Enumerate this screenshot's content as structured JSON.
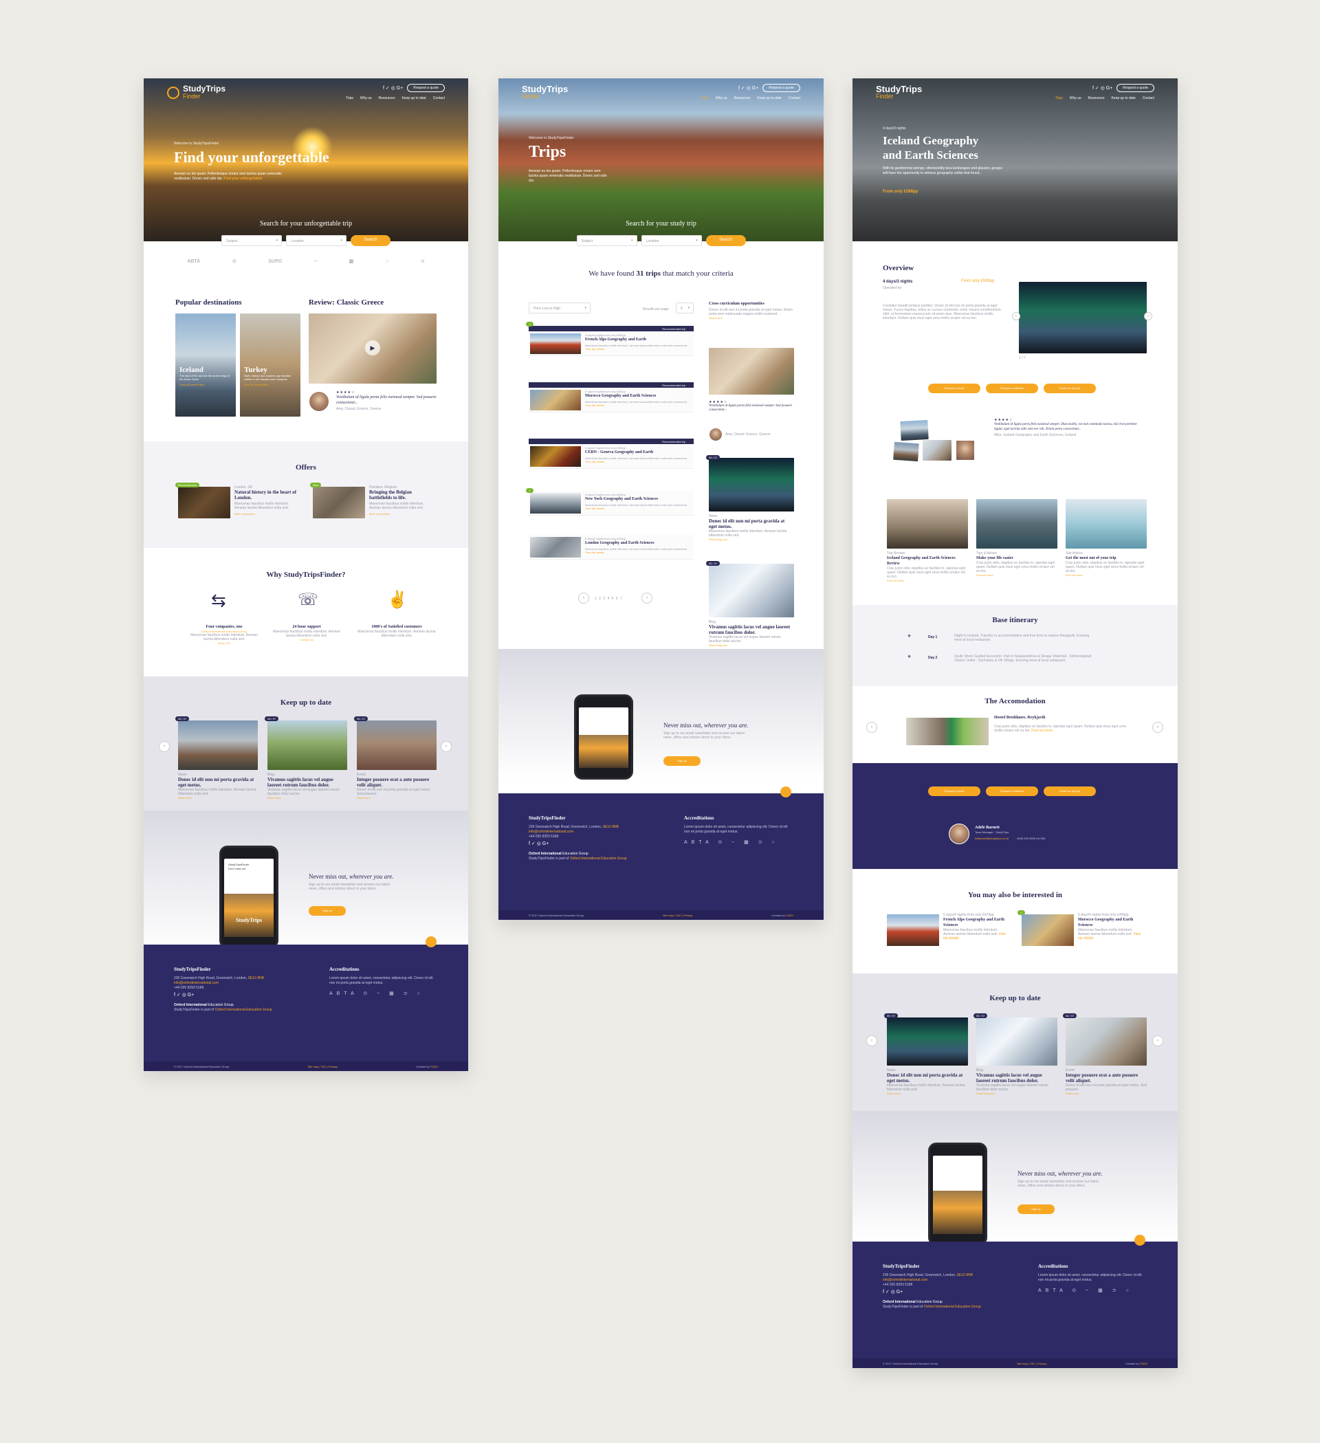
{
  "p1": {
    "logo_main": "StudyTrips",
    "logo_sub": "Finder",
    "social": "f  ✓  ◎  G+",
    "quote_btn": "Request a quote",
    "nav": [
      "Trips",
      "Why us",
      "Resources",
      "Keep up to date",
      "Contact"
    ],
    "welcome": "Welcome to StudyTripsFinder",
    "hero_title": "Find your unforgettable",
    "hero_text": "Aenean eu leo quam. Pellentesque ornare sem lacinia quam venenatis vestibulum. Donec sed odio dui.",
    "hero_link": "Find your unforgettable",
    "search_label": "Search for your unforgettable trip",
    "sel_subject": "Subject",
    "sel_location": "Location",
    "search_btn": "Search",
    "logos": [
      "ABTA",
      "⊙",
      "SUPO",
      "~",
      "▦",
      "○",
      "⊃"
    ],
    "popular_title": "Popular destinations",
    "review_title": "Review: Classic Greece",
    "dest1": {
      "name": "Iceland",
      "text": "The land of fire and ice lies at the edge of the Arctic Circle",
      "link": "View all Iceland trips"
    },
    "dest2": {
      "name": "Turkey",
      "text": "Myth, history and modern-day Istanbul collide in the bazaars and mosques",
      "link": "View all Turkey trips"
    },
    "review_stars": "★★★★☆",
    "review_quote": "Vestibulum id ligula porta felis euismod semper. Sed posuere consectetur...",
    "review_author": "Amy, Classic Greece, Greece",
    "offers_title": "Offers",
    "offer1": {
      "badge": "Recommended",
      "loc": "London, UK",
      "title": "Natural history in the heart of London.",
      "text": "Maecenas faucibus mollis interdum. Aenean lacinia bibendum nulla sed.",
      "link": "More information"
    },
    "offer2": {
      "badge": "New",
      "loc": "Flanders, Belgium",
      "title": "Bringing the Belgian battlefields to life.",
      "text": "Maecenas faucibus mollis interdum. Aenean lacinia bibendum nulla sed.",
      "link": "More information"
    },
    "why_title": "Why StudyTripsFinder?",
    "why1": {
      "title": "Four companies, one",
      "sub": "Oxford International Education Group",
      "text": "Maecenas faucibus mollis interdum. Aenean lacinia bibendum nulla sed.",
      "link": "About OTI"
    },
    "why2": {
      "title": "24 hour support",
      "text": "Maecenas faucibus mollis interdum. Aenean lacinia bibendum nulla sed.",
      "link": "Contact us"
    },
    "why3": {
      "title": "1000's of Satisfied customers",
      "text": "Maecenas faucibus mollis interdum. Aenean lacinia bibendum nulla sed."
    },
    "keep_title": "Keep up to date",
    "blog": [
      {
        "date": "06 / 07",
        "cat": "News",
        "title": "Donec id elit non mi porta gravida at eget metus.",
        "text": "Maecenas faucibus mollis interdum. Aenean lacinia bibendum nulla sed.",
        "link": "Read more"
      },
      {
        "date": "06 / 07",
        "cat": "Blog",
        "title": "Vivamus sagittis lacus vel augue laoreet rutrum faucibus dolor.",
        "text": "Vivamus sagittis lacus vel augue laoreet rutrum faucibus dolor auctor.",
        "link": "Read more"
      },
      {
        "date": "06 / 07",
        "cat": "Event",
        "title": "Integer posuere erat a ante posuere velit aliquet.",
        "text": "Donec id elit non mi porta gravida at eget metus. Sed posuere.",
        "link": "Read more"
      }
    ],
    "app_title_a": "Never miss out,",
    "app_title_b": "wherever you are.",
    "app_text": "Sign up to our email newsletter and receive our latest news, offers and articles direct to your inbox.",
    "app_btn": "Sign up",
    "phone_l1": "StudyTripsFinder",
    "phone_l2": "Don't miss out",
    "phone_l3": "StudyTrips",
    "footer": {
      "name": "StudyTripsFinder",
      "addr": "239 Greenwich High Road, Greenwich, London,",
      "postcode": "SE10 8NB",
      "email": "info@oxfordinternational.com",
      "phone": "+44 020 8293 5188",
      "social": "f  ✓  ◎  G+",
      "group": "Oxford International",
      "group_sub": "Education Group",
      "note": "StudyTripsFinder is part of",
      "note_link": "Oxford International Education Group",
      "accr_title": "Accreditations",
      "accr_text": "Lorem ipsum dolor sit amet, consectetur adipiscing elit. Donec id elit non mi porta gravida at eget metus.",
      "copy": "© 2017 Oxford International Education Group",
      "links": "Site map  |  T&C  |  Privacy",
      "credit": "Created by",
      "credit_link": "TGDH"
    }
  },
  "p2": {
    "logo_main": "StudyTrips",
    "logo_sub": "Finder",
    "social": "f  ✓  ◎  G+",
    "quote_btn": "Request a quote",
    "nav": [
      "Trips",
      "Why us",
      "Resources",
      "Keep up to date",
      "Contact"
    ],
    "welcome": "Welcome to StudyTripsFinder",
    "hero_title": "Trips",
    "hero_text": "Aenean eu leo quam. Pellentesque ornare sem lacinia quam venenatis vestibulum. Donec sed odio dui.",
    "search_label": "Search for your study trip",
    "sel_subject": "Subject",
    "sel_location": "Location",
    "search_btn": "Search",
    "found_a": "We have found",
    "found_count": "31 trips",
    "found_b": "that match your criteria",
    "sort": "Price Low to High",
    "per_page_label": "Results per page",
    "per_page": "5",
    "rec_label": "Recommended trip",
    "trips": [
      {
        "meta": "5 days/4 nights from only £549pp",
        "title": "French Alps Geography and Earth",
        "text": "Maecenas faucibus mollis interdum. Aenean lacinia bibendum nulla sed consectetur.",
        "link": "View trip details",
        "rec": true
      },
      {
        "meta": "5 days/4 nights from only £499pp",
        "title": "Morocco Geography and Earth Sciences",
        "text": "Maecenas faucibus mollis interdum. Aenean lacinia bibendum nulla sed consectetur.",
        "link": "View trip details",
        "rec": true
      },
      {
        "meta": "4 days/3 nights from only £399pp",
        "title": "CERN - Geneva Geography and Earth",
        "text": "Maecenas faucibus mollis interdum. Aenean lacinia bibendum nulla sed consectetur.",
        "link": "View trip details",
        "rec": true
      },
      {
        "meta": "5 days/4 nights from only £649pp",
        "title": "New York Geography and Earth Sciences",
        "text": "Maecenas faucibus mollis interdum. Aenean lacinia bibendum nulla sed consectetur.",
        "link": "View trip details",
        "rec": false
      },
      {
        "meta": "3 days/2 nights from only £199pp",
        "title": "London Geography and Earth Sciences",
        "text": "Maecenas faucibus mollis interdum. Aenean lacinia bibendum nulla sed consectetur.",
        "link": "View trip details",
        "rec": false
      }
    ],
    "pages": "1 2 3 4 5 6 7",
    "side_title": "Cross curriculum opportunities",
    "side_text": "Donec id elit non mi porta gravida at eget metus. Etiam porta sem malesuada magna mollis euismod.",
    "side_link": "Read more",
    "side_stars": "★★★★☆",
    "side_quote": "Vestibulum id ligula porta felis euismod semper. Sed posuere consectetur...",
    "side_author": "Amy, Classic Greece, Greece",
    "side_blog": [
      {
        "date": "06 / 07",
        "cat": "News",
        "title": "Donec id elit non mi porta gravida at eget metus.",
        "text": "Maecenas faucibus mollis interdum. Aenean lacinia bibendum nulla sed.",
        "link": "Read blog post"
      },
      {
        "date": "06 / 07",
        "cat": "Blog",
        "title": "Vivamus sagittis lacus vel augue laoreet rutrum faucibus dolor.",
        "text": "Vivamus sagittis lacus vel augue laoreet rutrum faucibus dolor auctor.",
        "link": "Read blog post"
      }
    ],
    "app_title_a": "Never miss out,",
    "app_title_b": "wherever you are.",
    "app_text": "Sign up to our email newsletter and receive our latest news, offers and articles direct to your inbox.",
    "app_btn": "Sign up",
    "footer": {
      "name": "StudyTripsFinder",
      "addr": "239 Greenwich High Road, Greenwich, London,",
      "postcode": "SE10 8NB",
      "email": "info@oxfordinternational.com",
      "phone": "+44 020 8293 5188",
      "social": "f  ✓  ◎  G+",
      "group": "Oxford International",
      "group_sub": "Education Group",
      "note": "StudyTripsFinder is part of",
      "note_link": "Oxford International Education Group",
      "accr_title": "Accreditations",
      "accr_text": "Lorem ipsum dolor sit amet, consectetur adipiscing elit. Donec id elit non mi porta gravida at eget metus.",
      "copy": "© 2017 Oxford International Education Group",
      "links": "Site map  |  T&C  |  Privacy",
      "credit": "Created by",
      "credit_link": "TGDH"
    }
  },
  "p3": {
    "logo_main": "StudyTrips",
    "logo_sub": "Finder",
    "social": "f  ✓  ◎  G+",
    "quote_btn": "Request a quote",
    "nav": [
      "Trips",
      "Why us",
      "Resources",
      "Keep up to date",
      "Contact"
    ],
    "duration": "4 days/3 nights",
    "hero_title_1": "Iceland Geography",
    "hero_title_2": "and Earth Sciences",
    "hero_text": "With its geothermal springs, otherworldly lava landscapes and glaciers, groups will have the opportunity to witness geography unlike that found...",
    "hero_price": "From only £599pp",
    "overview_title": "Overview",
    "ov_duration": "4 days/3 nights",
    "ov_price": "From only £599pp",
    "ov_provider": "Operated by",
    "ov_text": "Curabitur blandit tempus porttitor. Donec id elit non mi porta gravida at eget metus. Fusce dapibus, tellus ac cursus commodo, tortor mauris condimentum nibh, ut fermentum massa justo sit amet risus. Maecenas faucibus mollis interdum. Nullam quis risus eget urna mollis ornare vel eu leo.",
    "gallery_count": "1 / 7",
    "btn_quote": "Request a quote",
    "btn_callback": "Request a callback",
    "btn_email": "Email me my trip",
    "t_stars": "★★★★☆",
    "t_quote": "Vestibulum id ligula porta felis euismod semper. Duis mollis, est non commodo luctus, nisi erat porttitor ligula, eget lacinia odio sem nec elit. Etiam porta consectetur...",
    "t_author": "Mike, Iceland Geography and Earth Sciences, Iceland",
    "feat": [
      {
        "cat": "Trip Review",
        "title": "Iceland Geography and Earth Sciences Review",
        "text": "Cras justo odio, dapibus ac facilisis in, egestas eget quam. Nullam quis risus eget urna mollis ornare vel eu leo.",
        "link": "Find out more"
      },
      {
        "cat": "Tips & Advice",
        "title": "Make your life easier",
        "text": "Cras justo odio, dapibus ac facilisis in, egestas eget quam. Nullam quis risus eget urna mollis ornare vel eu leo.",
        "link": "Find out more"
      },
      {
        "cat": "Site Advice",
        "title": "Get the most out of your trip",
        "text": "Cras justo odio, dapibus ac facilisis in, egestas eget quam. Nullam quis risus eget urna mollis ornare vel eu leo.",
        "link": "Find out more"
      }
    ],
    "itin_title": "Base itinerary",
    "itin": [
      {
        "day": "Day 1",
        "text": "Flight to Iceland. Transfer to accommodation and free time to explore Reykjavik. Evening meal at local restaurant."
      },
      {
        "day": "Day 2",
        "text": "South Shore Guided Excursion: Visit to Seljalandsfoss & Skogar Waterfall - Solheimajokull Glacier Outlet - Dyrholaey & Vik Village. Evening meal at local restaurant."
      }
    ],
    "acc_title": "The Accomodation",
    "acc_name": "Hostel Broddanes, Reykjavik",
    "acc_text": "Cras justo odio, dapibus ac facilisis in, egestas eget quam. Nullam quis risus eget urna mollis ornare vel eu leo.",
    "acc_link": "Find out more",
    "contact_name": "Adele Barnett",
    "contact_role": "Team Manager - StudyTrips",
    "contact_email": "Adbarnett@studytrips.co.uk",
    "contact_phone": "0845 200 5555 ext 555",
    "also_title": "You may also be interested in",
    "also": [
      {
        "meta": "5 days/4 nights from only £479pp",
        "title": "French Alps Geography and Earth Sciences",
        "text": "Maecenas faucibus mollis interdum. Aenean lacinia bibendum nulla sed.",
        "link": "View trip details"
      },
      {
        "meta": "5 days/4 nights from only £499pp",
        "title": "Morocco Geography and Earth Sciences",
        "text": "Maecenas faucibus mollis interdum. Aenean lacinia bibendum nulla sed.",
        "link": "View trip details"
      }
    ],
    "keep_title": "Keep up to date",
    "blog": [
      {
        "date": "06 / 07",
        "cat": "News",
        "title": "Donec id elit non mi porta gravida at eget metus.",
        "text": "Maecenas faucibus mollis interdum. Aenean lacinia bibendum nulla sed.",
        "link": "Read more"
      },
      {
        "date": "06 / 07",
        "cat": "Blog",
        "title": "Vivamus sagittis lacus vel augue laoreet rutrum faucibus dolor.",
        "text": "Vivamus sagittis lacus vel augue laoreet rutrum faucibus dolor auctor.",
        "link": "Read blog post"
      },
      {
        "date": "06 / 07",
        "cat": "Event",
        "title": "Integer posuere erat a ante posuere velit aliquet.",
        "text": "Donec id elit non mi porta gravida at eget metus. Sed posuere.",
        "link": "Read more"
      }
    ],
    "app_title_a": "Never miss out,",
    "app_title_b": "wherever you are.",
    "app_text": "Sign up to our email newsletter and receive our latest news, offers and articles direct to your inbox.",
    "app_btn": "Sign up",
    "footer": {
      "name": "StudyTripsFinder",
      "addr": "239 Greenwich High Road, Greenwich, London,",
      "postcode": "SE10 8NB",
      "email": "info@oxfordinternational.com",
      "phone": "+44 020 8293 5188",
      "social": "f  ✓  ◎  G+",
      "group": "Oxford International",
      "group_sub": "Education Group",
      "note": "StudyTripsFinder is part of",
      "note_link": "Oxford International Education Group",
      "accr_title": "Accreditations",
      "accr_text": "Lorem ipsum dolor sit amet, consectetur adipiscing elit. Donec id elit non mi porta gravida at eget metus.",
      "copy": "© 2017 Oxford International Education Group",
      "links": "Site map  |  T&C  |  Privacy",
      "credit": "Created by",
      "credit_link": "TGDH"
    }
  },
  "colors": {
    "accent": "#f7a823",
    "navy": "#2e2a66",
    "green": "#7cb82f",
    "bg": "#ecebe6"
  }
}
